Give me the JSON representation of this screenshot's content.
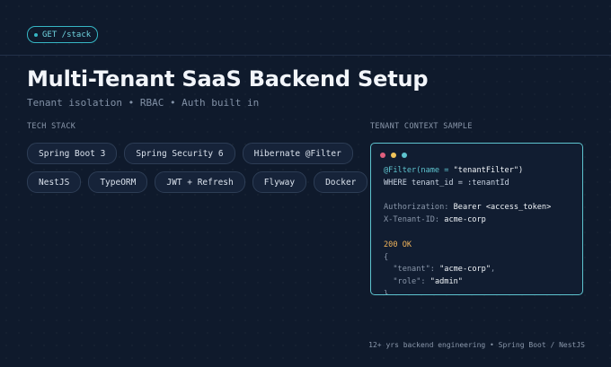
{
  "endpoint_badge": {
    "label": "GET /stack"
  },
  "title": "Multi-Tenant SaaS Backend Setup",
  "subtitle": "Tenant isolation • RBAC • Auth built in",
  "tech_stack": {
    "label": "TECH STACK",
    "rows": [
      [
        "Spring Boot 3",
        "Spring Security 6",
        "Hibernate @Filter"
      ],
      [
        "NestJS",
        "TypeORM",
        "JWT + Refresh",
        "Flyway",
        "Docker"
      ]
    ]
  },
  "tenant_context": {
    "label": "TENANT CONTEXT SAMPLE",
    "window_dots": [
      "red",
      "yellow",
      "teal"
    ],
    "lines": [
      [
        {
          "t": "@Filter(name = ",
          "c": "#5ec4cf"
        },
        {
          "t": "\"tenantFilter\"",
          "c": "#f0f4f8"
        },
        {
          "t": ")",
          "c": "#f0f4f8"
        }
      ],
      [
        {
          "t": "WHERE tenant_id = :tenantId",
          "c": "#c9d4e3"
        }
      ],
      [],
      [
        {
          "t": "Authorization: ",
          "c": "#8a97aa"
        },
        {
          "t": "Bearer <access_token>",
          "c": "#f0f4f8"
        }
      ],
      [
        {
          "t": "X-Tenant-ID: ",
          "c": "#8a97aa"
        },
        {
          "t": "acme-corp",
          "c": "#f0f4f8"
        }
      ],
      [],
      [
        {
          "t": "200 OK",
          "c": "#f0b35a"
        }
      ],
      [
        {
          "t": "{",
          "c": "#8a97aa"
        }
      ],
      [
        {
          "t": "  \"tenant\"",
          "c": "#8a97aa"
        },
        {
          "t": ": ",
          "c": "#8a97aa"
        },
        {
          "t": "\"acme-corp\"",
          "c": "#f0f4f8"
        },
        {
          "t": ",",
          "c": "#8a97aa"
        }
      ],
      [
        {
          "t": "  \"role\"",
          "c": "#8a97aa"
        },
        {
          "t": ": ",
          "c": "#8a97aa"
        },
        {
          "t": "\"admin\"",
          "c": "#f0f4f8"
        }
      ],
      [
        {
          "t": "}",
          "c": "#8a97aa"
        }
      ]
    ]
  },
  "footer": "12+ yrs backend engineering • Spring Boot / NestJS",
  "colors": {
    "accent": "#36b6c4",
    "background": "#0f1a2c",
    "dot_red": "#e0607e",
    "dot_yellow": "#f0c45a",
    "dot_teal": "#5ec4cf"
  }
}
